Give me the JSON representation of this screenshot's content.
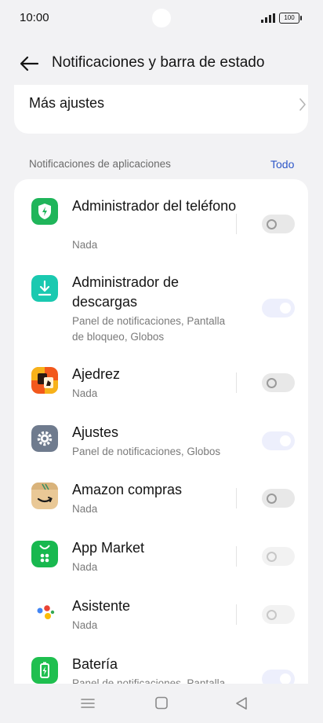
{
  "status": {
    "time": "10:00",
    "battery": "100"
  },
  "header": {
    "title": "Notificaciones y barra de estado"
  },
  "more": {
    "label": "Más ajustes"
  },
  "section": {
    "title": "Notificaciones de aplicaciones",
    "link": "Todo"
  },
  "apps": [
    {
      "name": "Administrador del teléfono",
      "sub": "Nada",
      "enabled": false,
      "icon": "shield-icon"
    },
    {
      "name": "Administrador de descargas",
      "sub": "Panel de notificaciones, Pantalla de bloqueo, Globos",
      "enabled": true,
      "icon": "download-icon"
    },
    {
      "name": "Ajedrez",
      "sub": "Nada",
      "enabled": false,
      "icon": "chess-icon"
    },
    {
      "name": "Ajustes",
      "sub": "Panel de notificaciones, Globos",
      "enabled": true,
      "icon": "gear-icon"
    },
    {
      "name": "Amazon compras",
      "sub": "Nada",
      "enabled": false,
      "icon": "amazon-icon"
    },
    {
      "name": "App Market",
      "sub": "Nada",
      "enabled": false,
      "icon": "app-market-icon"
    },
    {
      "name": "Asistente",
      "sub": "Nada",
      "enabled": false,
      "icon": "assistant-icon"
    },
    {
      "name": "Batería",
      "sub": "Panel de notificaciones, Pantalla",
      "enabled": true,
      "icon": "battery-icon"
    }
  ],
  "colors": {
    "accent": "#2e57c8",
    "toggle_on": "#dfe3fb",
    "toggle_off": "#e8e8e8"
  }
}
